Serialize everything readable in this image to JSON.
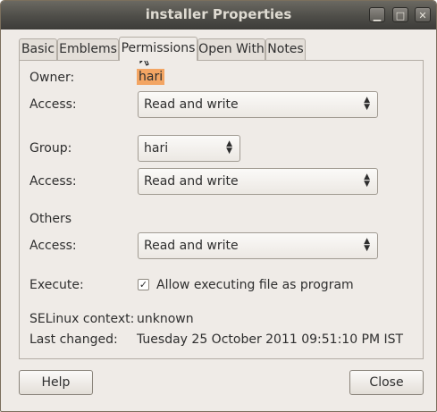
{
  "window": {
    "title": "installer Properties"
  },
  "title_buttons": {
    "minimize": "▁",
    "maximize": "□",
    "close": "✕"
  },
  "tabs": [
    {
      "label": "Basic"
    },
    {
      "label": "Emblems"
    },
    {
      "label": "Permissions",
      "active": true
    },
    {
      "label": "Open With"
    },
    {
      "label": "Notes"
    }
  ],
  "permissions": {
    "owner_label": "Owner:",
    "owner_value": "hari",
    "owner_access_label": "Access:",
    "owner_access_value": "Read and write",
    "group_label": "Group:",
    "group_value": "hari",
    "group_access_label": "Access:",
    "group_access_value": "Read and write",
    "others_label": "Others",
    "others_access_label": "Access:",
    "others_access_value": "Read and write",
    "execute_label": "Execute:",
    "execute_checkbox_label": "Allow executing file as program",
    "execute_checked": true,
    "selinux_label": "SELinux context:",
    "selinux_value": "unknown",
    "last_changed_label": "Last changed:",
    "last_changed_value": "Tuesday 25 October 2011 09:51:10 PM IST"
  },
  "buttons": {
    "help": "Help",
    "close": "Close"
  },
  "icons": {
    "combo_arrows": "up-down-arrows-icon",
    "checkmark": "check-icon",
    "cursor": "mouse-pointer-icon"
  }
}
